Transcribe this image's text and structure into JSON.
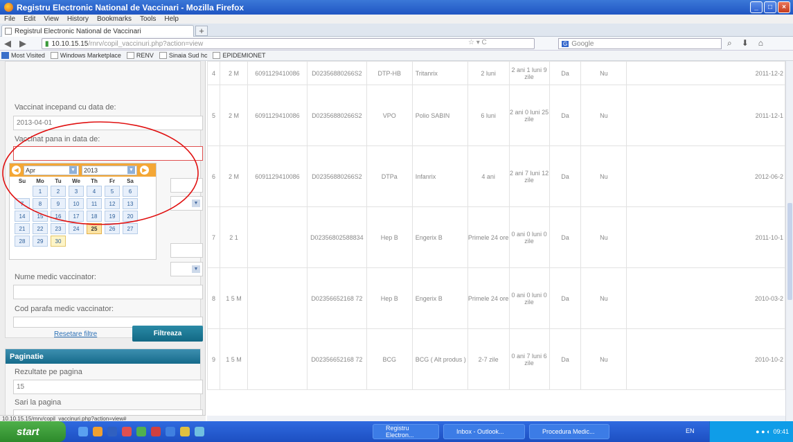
{
  "window": {
    "title": "Registru Electronic National de Vaccinari - Mozilla Firefox"
  },
  "menu": [
    "File",
    "Edit",
    "View",
    "History",
    "Bookmarks",
    "Tools",
    "Help"
  ],
  "tab": {
    "label": "Registrul Electronic National de Vaccinari",
    "new": "+"
  },
  "nav": {
    "url_host": "10.10.15.15",
    "url_path": "/rnrv/copil_vaccinuri.php?action=view",
    "search_placeholder": "Google"
  },
  "bookmarks": [
    "Most Visited",
    "Windows Marketplace",
    "RENV",
    "Sinaia Sud hc",
    "EPIDEMIONET"
  ],
  "filters": {
    "from_label": "Vaccinat incepand cu data de:",
    "from_value": "2013-04-01",
    "to_label": "Vaccinat pana in data de:",
    "to_value": "",
    "medic_label": "Nume medic vaccinator:",
    "parafa_label": "Cod parafa medic vaccinator:",
    "reset": "Resetare filtre",
    "filter": "Filtreaza"
  },
  "calendar": {
    "month": "Apr",
    "year": "2013",
    "days": [
      "Su",
      "Mo",
      "Tu",
      "We",
      "Th",
      "Fr",
      "Sa"
    ],
    "weeks": [
      [
        "",
        "1",
        "2",
        "3",
        "4",
        "5",
        "6"
      ],
      [
        "7",
        "8",
        "9",
        "10",
        "11",
        "12",
        "13"
      ],
      [
        "14",
        "15",
        "16",
        "17",
        "18",
        "19",
        "20"
      ],
      [
        "21",
        "22",
        "23",
        "24",
        "25",
        "26",
        "27"
      ],
      [
        "28",
        "29",
        "30",
        "",
        "",
        "",
        ""
      ]
    ],
    "today": "25",
    "selected": "30"
  },
  "pagination": {
    "header": "Paginatie",
    "per_page_label": "Rezultate pe pagina",
    "per_page_value": "15",
    "jump_label": "Sari la pagina"
  },
  "rows": [
    {
      "nr": "4",
      "age": "2 M",
      "cnp": "6091129410086",
      "code": "D02356880266S2",
      "vaccine": "DTP-HB",
      "product": "Tritanrix",
      "dose": "2 luni",
      "interval": "2 ani 1 luni 9 zile",
      "c1": "Da",
      "c2": "Nu",
      "date": "2011-12-2"
    },
    {
      "nr": "5",
      "age": "2 M",
      "cnp": "6091129410086",
      "code": "D02356880266S2",
      "vaccine": "VPO",
      "product": "Polio SABIN",
      "dose": "6 luni",
      "interval": "2 ani 0 luni 25 zile",
      "c1": "Da",
      "c2": "Nu",
      "date": "2011-12-1"
    },
    {
      "nr": "6",
      "age": "2 M",
      "cnp": "6091129410086",
      "code": "D02356880266S2",
      "vaccine": "DTPa",
      "product": "Infanrix",
      "dose": "4 ani",
      "interval": "2 ani 7 luni 12 zile",
      "c1": "Da",
      "c2": "Nu",
      "date": "2012-06-2"
    },
    {
      "nr": "7",
      "age": "2 1",
      "cnp": "",
      "code": "D02356802588834",
      "vaccine": "Hep B",
      "product": "Engerix B",
      "dose": "Primele 24 ore",
      "interval": "0 ani 0 luni 0 zile",
      "c1": "Da",
      "c2": "Nu",
      "date": "2011-10-1"
    },
    {
      "nr": "8",
      "age": "1 5 M",
      "cnp": "",
      "code": "D02356652168 72",
      "vaccine": "Hep B",
      "product": "Engerix B",
      "dose": "Primele 24 ore",
      "interval": "0 ani 0 luni 0 zile",
      "c1": "Da",
      "c2": "Nu",
      "date": "2010-03-2"
    },
    {
      "nr": "9",
      "age": "1 5 M",
      "cnp": "",
      "code": "D02356652168 72",
      "vaccine": "BCG",
      "product": "BCG ( Alt produs )",
      "dose": "2-7 zile",
      "interval": "0 ani 7 luni 6 zile",
      "c1": "Da",
      "c2": "Nu",
      "date": "2010-10-2"
    }
  ],
  "status": {
    "url": "10.10.15.15/rnrv/copil_vaccinuri.php?action=view#"
  },
  "taskbar": {
    "start": "start",
    "items": [
      "Registru Electron...",
      "Inbox - Outlook...",
      "Procedura Medic..."
    ],
    "lang": "EN",
    "clock": "09:41"
  },
  "colors": {
    "accent": "#f4a735",
    "button": "#136985",
    "annotation": "#e01010"
  }
}
